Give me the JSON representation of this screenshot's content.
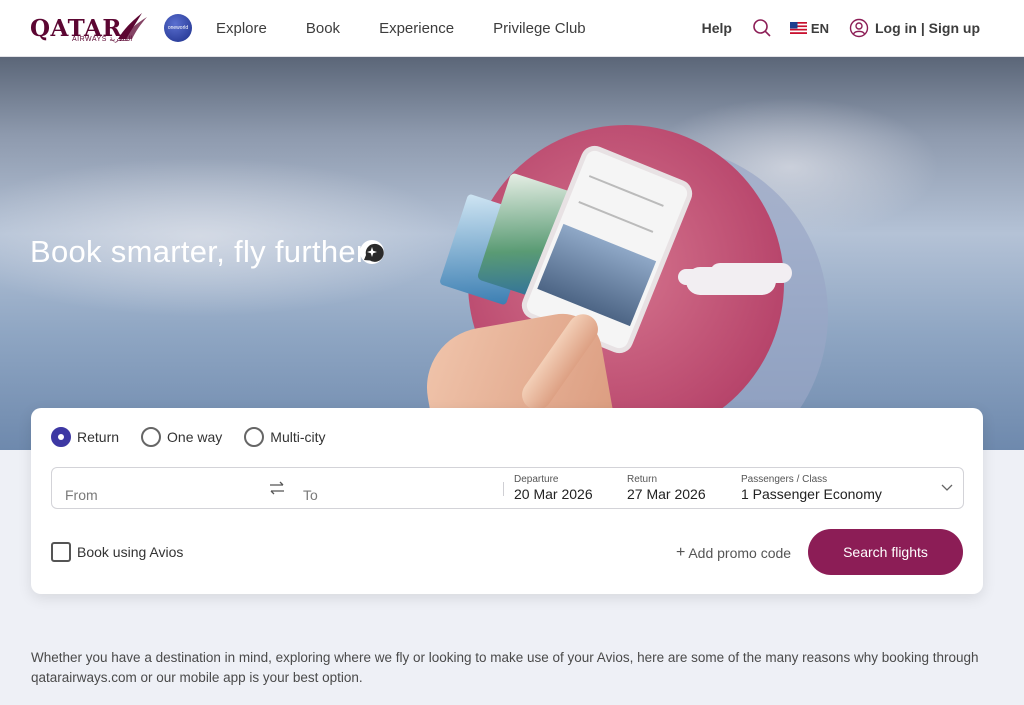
{
  "header": {
    "logo_text": "QATAR",
    "logo_sub": "AIRWAYS القطرية",
    "alliance_badge": "oneworld",
    "nav": [
      "Explore",
      "Book",
      "Experience",
      "Privilege Club"
    ],
    "help": "Help",
    "language": "EN",
    "login": "Log in | Sign up"
  },
  "hero": {
    "title": "Book smarter, fly further",
    "ai_icon": "sparkle-chat-icon"
  },
  "booking": {
    "trip_types": [
      {
        "label": "Return",
        "checked": true
      },
      {
        "label": "One way",
        "checked": false
      },
      {
        "label": "Multi-city",
        "checked": false
      }
    ],
    "from_placeholder": "From",
    "to_placeholder": "To",
    "departure_label": "Departure",
    "departure_value": "20 Mar 2026",
    "return_label": "Return",
    "return_value": "27 Mar 2026",
    "passengers_label": "Passengers / Class",
    "passengers_value": "1 Passenger Economy",
    "avios_label": "Book using Avios",
    "promo_label": "Add promo code",
    "search_label": "Search flights"
  },
  "intro": "Whether you have a destination in mind, exploring where we fly or looking to make use of your Avios, here are some of the many reasons why booking through qatarairways.com or our mobile app is your best option.",
  "colors": {
    "brand": "#5c0632",
    "button": "#8c1d56",
    "radio_accent": "#3d38a3"
  }
}
